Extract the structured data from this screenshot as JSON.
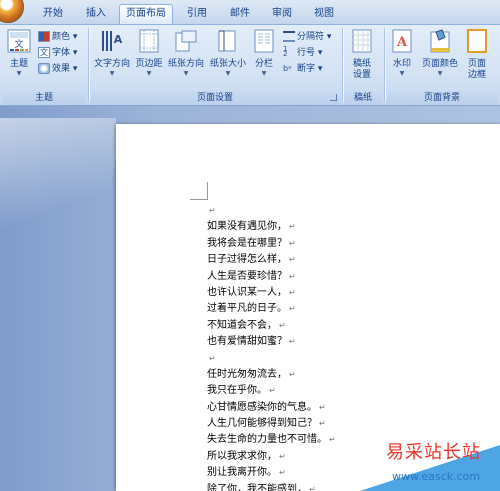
{
  "tabs": [
    {
      "label": "开始",
      "active": false
    },
    {
      "label": "插入",
      "active": false
    },
    {
      "label": "页面布局",
      "active": true
    },
    {
      "label": "引用",
      "active": false
    },
    {
      "label": "邮件",
      "active": false
    },
    {
      "label": "审阅",
      "active": false
    },
    {
      "label": "视图",
      "active": false
    }
  ],
  "ribbon": {
    "theme": {
      "label": "主题",
      "buttons": {
        "themes": "主题",
        "colors": "颜色",
        "fonts": "字体",
        "effects": "效果"
      }
    },
    "page_setup": {
      "label": "页面设置",
      "buttons": {
        "text_direction": "文字方向",
        "margins": "页边距",
        "orientation": "纸张方向",
        "size": "纸张大小",
        "columns": "分栏",
        "breaks": "分隔符",
        "line_numbers": "行号",
        "hyphenation": "断字"
      }
    },
    "draft_paper": {
      "label": "稿纸",
      "button": "稿纸设置"
    },
    "page_background": {
      "label": "页面背景",
      "buttons": {
        "watermark": "水印",
        "page_color": "页面颜色",
        "page_borders": "页面边框"
      }
    }
  },
  "document": {
    "lines": [
      "",
      "如果没有遇见你，",
      "我将会是在哪里？",
      "日子过得怎么样，",
      "人生是否要珍惜？",
      "也许认识某一人，",
      "过着平凡的日子。",
      "不知道会不会，",
      "也有爱情甜如蜜？",
      "",
      "任时光匆匆流去，",
      "我只在乎你。",
      "心甘情愿感染你的气息。",
      "人生几何能够得到知己？",
      "失去生命的力量也不可惜。",
      "所以我求求你，",
      "别让我离开你。",
      "除了你，我不能感到，"
    ],
    "paragraph_mark": "↵"
  },
  "watermark": {
    "text": "易采站长站",
    "url": "www.easck.com"
  },
  "colors": {
    "ribbon_text": "#15428b",
    "watermark_red": "#e8362b",
    "watermark_blue": "#3b9be0"
  }
}
